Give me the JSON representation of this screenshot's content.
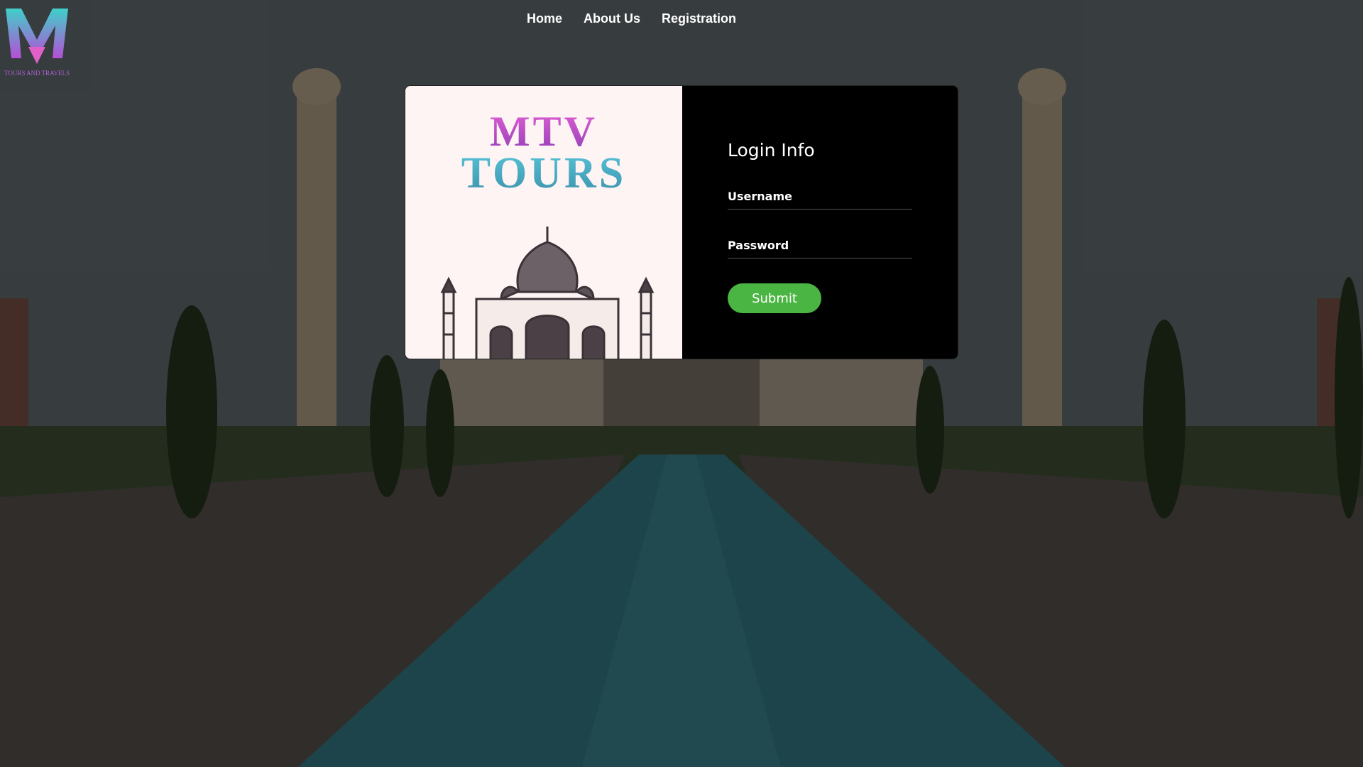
{
  "logo": {
    "mark_label": "MTV",
    "caption": "TOURS AND TRAVELS"
  },
  "nav": {
    "home": "Home",
    "about": "About Us",
    "registration": "Registration"
  },
  "brand": {
    "line1": "MTV",
    "line2": "TOURS"
  },
  "login": {
    "title": "Login Info",
    "username_placeholder": "Username",
    "password_placeholder": "Password",
    "submit_label": "Submit"
  },
  "colors": {
    "submit_green": "#4bb543",
    "card_right_bg": "#000000",
    "card_left_bg": "#fdf4f3",
    "brand_purple": "#c050d0",
    "brand_teal": "#4ab3cc"
  }
}
